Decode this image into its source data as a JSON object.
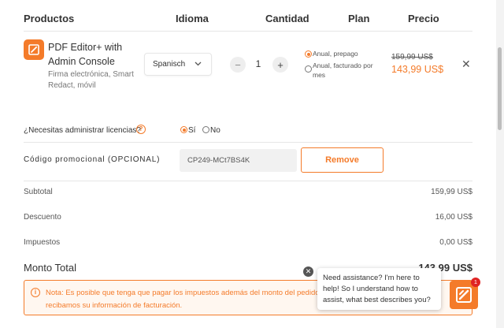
{
  "header": {
    "productos": "Productos",
    "idioma": "Idioma",
    "cantidad": "Cantidad",
    "plan": "Plan",
    "precio": "Precio"
  },
  "product": {
    "name": "PDF Editor+ with Admin Console",
    "description": "Firma electrónica, Smart Redact, móvil",
    "icon": "pdf-editor-icon",
    "language_selected": "Spanisch",
    "quantity": "1",
    "minus_label": "−",
    "plus_label": "+",
    "plan_options": [
      {
        "label": "Anual, prepago",
        "selected": true
      },
      {
        "label": "Anual, facturado por mes",
        "selected": false
      }
    ],
    "old_price": "159,99 US$",
    "new_price": "143,99 US$"
  },
  "licenses": {
    "question": "¿Necesitas administrar licencias?",
    "yes_label": "Sí",
    "no_label": "No",
    "selected": "Sí"
  },
  "promo": {
    "label": "Código promocional (OPCIONAL)",
    "code": "CP249-MCt7BS4K",
    "remove_label": "Remove"
  },
  "summary": {
    "subtotal_label": "Subtotal",
    "subtotal_value": "159,99 US$",
    "discount_label": "Descuento",
    "discount_value": "16,00 US$",
    "tax_label": "Impuestos",
    "tax_value": "0,00 US$",
    "total_label": "Monto Total",
    "total_value": "143,99 US$"
  },
  "notice": {
    "line1": "Nota: Es posible que tenga que pagar los impuestos además del monto del pedido",
    "line2": "recibamos su información de facturación."
  },
  "chat": {
    "message": "Need assistance? I'm here to help! So I understand how to assist, what best describes you?",
    "badge_count": "1"
  },
  "colors": {
    "accent": "#f47b2a",
    "text": "#333333",
    "muted": "#777777",
    "notice_bg": "#fff7f0",
    "badge": "#e02424"
  }
}
